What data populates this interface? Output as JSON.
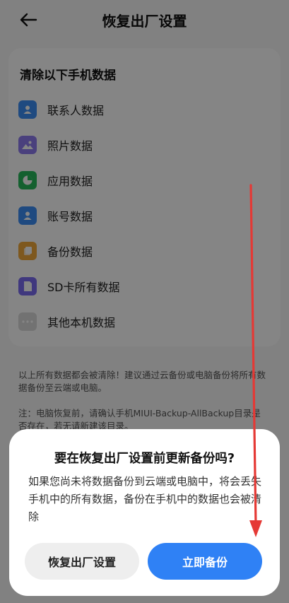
{
  "header": {
    "title": "恢复出厂设置",
    "back_icon": "arrow-left-icon"
  },
  "card": {
    "title": "清除以下手机数据",
    "items": [
      {
        "label": "联系人数据",
        "icon": "contact-icon",
        "color": "#3d8ef5"
      },
      {
        "label": "照片数据",
        "icon": "photo-icon",
        "color": "#8f7cf0"
      },
      {
        "label": "应用数据",
        "icon": "app-icon",
        "color": "#28b85a"
      },
      {
        "label": "账号数据",
        "icon": "account-icon",
        "color": "#3d8ef5"
      },
      {
        "label": "备份数据",
        "icon": "backup-icon",
        "color": "#f2a93b"
      },
      {
        "label": "SD卡所有数据",
        "icon": "sd-card-icon",
        "color": "#7b6cf2"
      },
      {
        "label": "其他本机数据",
        "icon": "more-icon",
        "color": "#dadada"
      }
    ]
  },
  "notes": {
    "warning": "以上所有数据都会被清除！建议通过云备份或电脑备份将所有数据备份至云端或电脑。",
    "tip": "注：电脑恢复前，请确认手机MIUI-Backup-AllBackup目录是否存在，若无请新建该目录。"
  },
  "dialog": {
    "title": "要在恢复出厂设置前更新备份吗?",
    "message": "如果您尚未将数据备份到云端或电脑中，将会丢失手机中的所有数据，备份在手机中的数据也会被清除",
    "cancel_label": "恢复出厂设置",
    "confirm_label": "立即备份"
  },
  "colors": {
    "accent": "#2f81f5",
    "annotation_arrow": "#e53935"
  }
}
